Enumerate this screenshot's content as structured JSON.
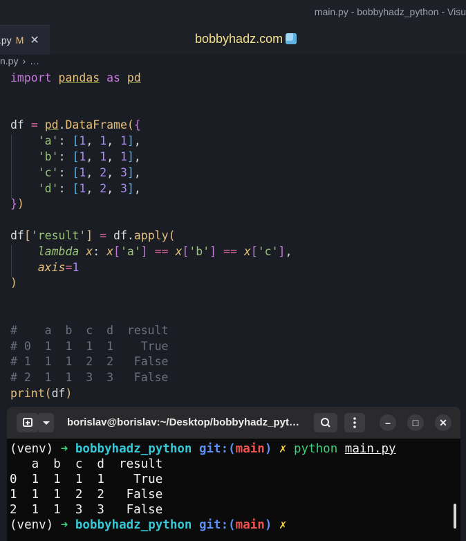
{
  "window": {
    "title": "main.py - bobbyhadz_python - Visu"
  },
  "tab": {
    "name": ".py",
    "modified": "M",
    "close": "✕"
  },
  "site": {
    "label": "bobbyhadz.com",
    "icon": "ice-cube-icon"
  },
  "breadcrumb": {
    "file": "n.py",
    "sep": "›",
    "more": "…"
  },
  "editor": {
    "lines": [
      "import pandas as pd",
      "",
      "",
      "df = pd.DataFrame({",
      "    'a': [1, 1, 1],",
      "    'b': [1, 1, 1],",
      "    'c': [1, 2, 3],",
      "    'd': [1, 2, 3],",
      "})",
      "",
      "df['result'] = df.apply(",
      "    lambda x: x['a'] == x['b'] == x['c'],",
      "    axis=1",
      ")",
      "",
      "",
      "#    a  b  c  d  result",
      "# 0  1  1  1  1    True",
      "# 1  1  1  2  2   False",
      "# 2  1  1  3  3   False",
      "print(df)"
    ]
  },
  "terminal": {
    "title": "borislav@borislav:~/Desktop/bobbyhadz_pyt…",
    "buttons": {
      "new_tab": "+",
      "dropdown": "▾",
      "search": "search-icon",
      "menu": "⋮",
      "minimize": "–",
      "maximize": "□",
      "close": "✕"
    },
    "prompt": {
      "venv": "(venv)",
      "arrow": "➜",
      "dir": "bobbyhadz_python",
      "git": "git:(",
      "branch": "main",
      "git_close": ")",
      "dirty": "✗"
    },
    "command": {
      "cmd": "python",
      "file": "main.py"
    },
    "output": [
      "   a  b  c  d  result",
      "0  1  1  1  1    True",
      "1  1  1  2  2   False",
      "2  1  1  3  3   False"
    ]
  },
  "colors": {
    "editor_bg": "#1b1d24",
    "terminal_bg": "#0b0b0c",
    "accent": "#f3e08a"
  }
}
